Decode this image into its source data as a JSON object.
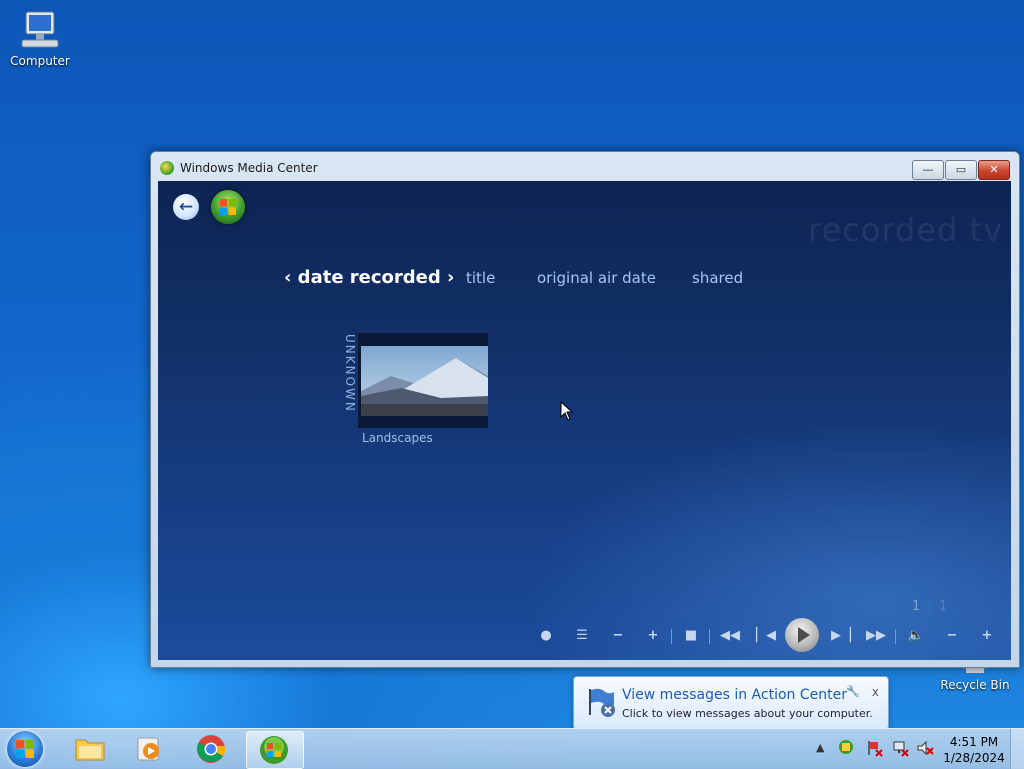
{
  "desktop": {
    "computer_label": "Computer",
    "recycle_label": "Recycle Bin"
  },
  "window": {
    "title": "Windows Media Center",
    "minimize": "—",
    "maximize": "▭",
    "close": "✕"
  },
  "wmc": {
    "section_title": "recorded tv",
    "nav": {
      "date_recorded": "‹ date recorded ›",
      "title": "title",
      "original_air_date": "original air date",
      "shared": "shared"
    },
    "group_label": "UNKNOWN",
    "item_label": "Landscapes",
    "pager_current": "1",
    "pager_total": "1"
  },
  "balloon": {
    "title": "View messages in Action Center",
    "text": "Click to view messages about your computer.",
    "close": "x"
  },
  "clock": {
    "time": "4:51 PM",
    "date": "1/28/2024"
  }
}
